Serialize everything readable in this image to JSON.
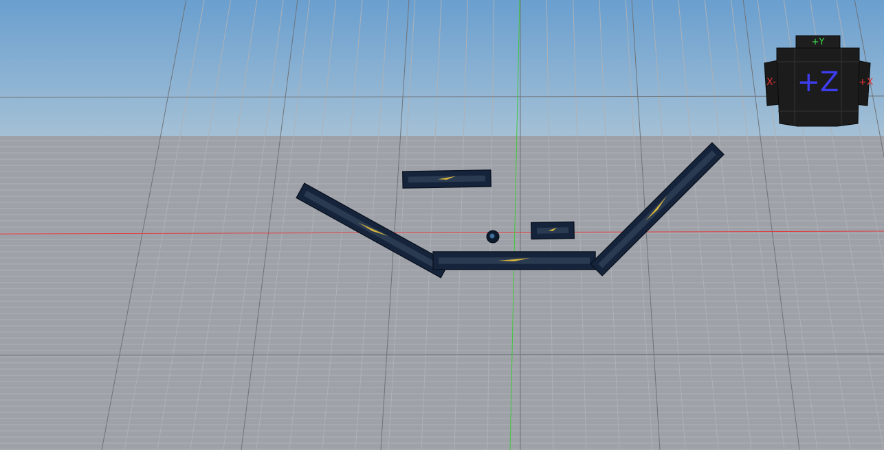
{
  "viewport": {
    "colors": {
      "sky_top": "#6a9fcf",
      "sky_bottom": "#a9c3d6",
      "ground": "#9ea2a8",
      "grid_minor": "#aeb1b6",
      "grid_major": "#6f7379",
      "x_axis": "#e0393d",
      "y_axis": "#41c83c",
      "part_fill": "#16243b",
      "part_inner": "#2a3a50",
      "arrow": "#d4b43e"
    },
    "parts": [
      "left-ramp-part",
      "floor-part",
      "right-ramp-part",
      "floating-block-large",
      "floating-block-small",
      "ball"
    ]
  },
  "view_cube": {
    "top_label": "+Y",
    "front_label": "+Z",
    "left_label": "X-",
    "right_label": "+X",
    "colors": {
      "face": "#1c1c1c",
      "edge": "#0c0c0c",
      "y_label": "#3bd84a",
      "z_label": "#3d3df2",
      "x_label": "#e23232"
    }
  }
}
